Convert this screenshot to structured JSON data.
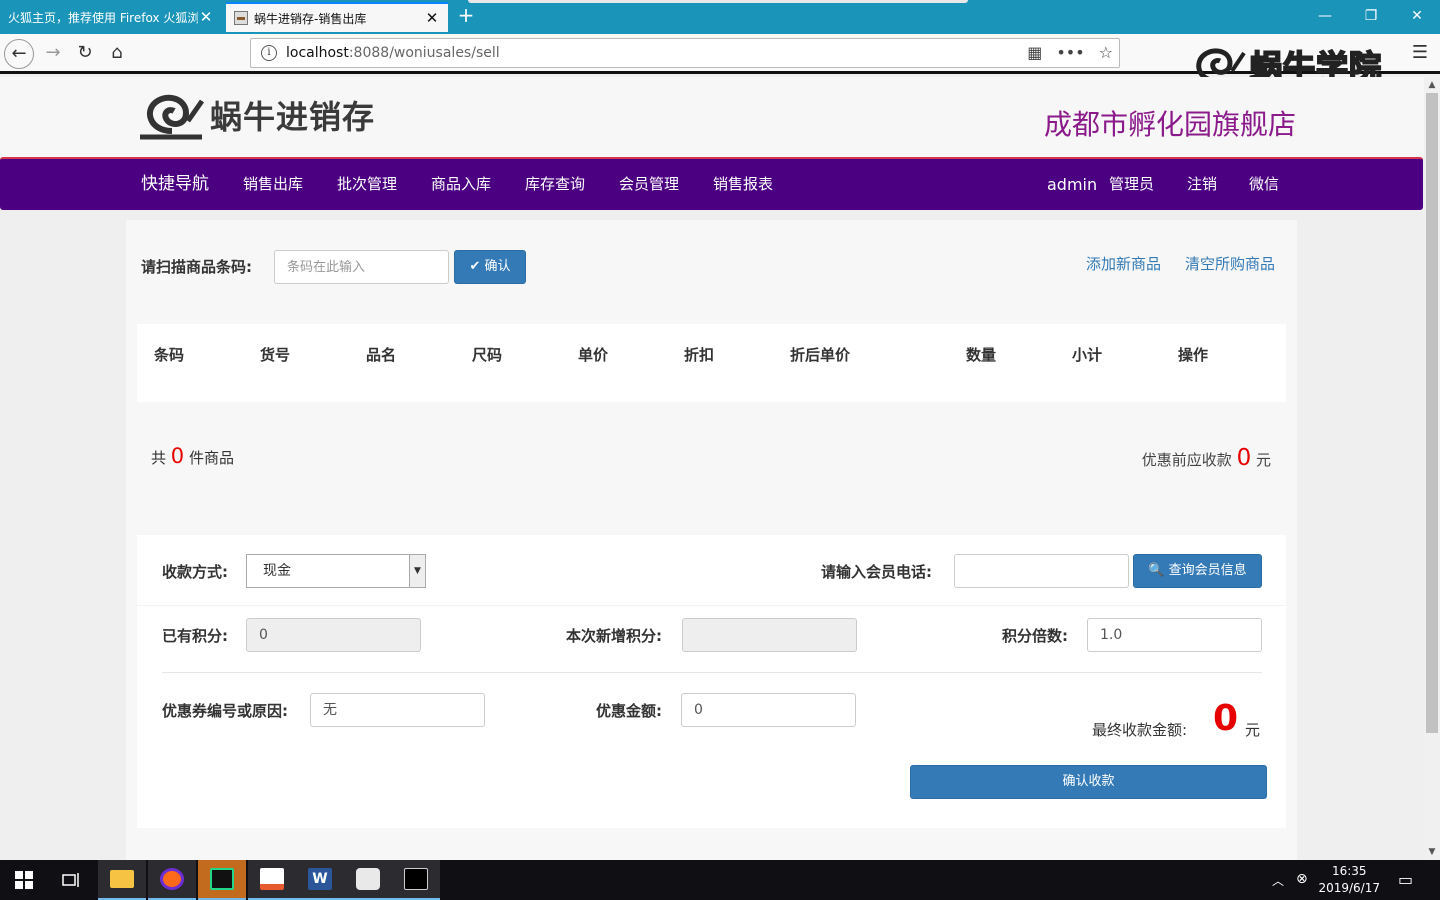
{
  "browser": {
    "tabs": [
      {
        "title": "火狐主页，推荐使用 Firefox 火狐浏览",
        "active": false
      },
      {
        "title": "蜗牛进销存-销售出库",
        "active": true
      }
    ],
    "new_tab": "+",
    "url_host": "localhost",
    "url_path": ":8088/woniusales/sell",
    "icons": [
      "back-icon",
      "forward-icon",
      "reload-icon",
      "home-icon",
      "info-icon",
      "qr-icon",
      "more-icon",
      "bookmark-icon",
      "menu-icon"
    ],
    "watermark_text": "蜗牛学院"
  },
  "header": {
    "logo_text": "蜗牛进销存",
    "store_name": "成都市孵化园旗舰店"
  },
  "nav": {
    "brand": "快捷导航",
    "items": [
      "销售出库",
      "批次管理",
      "商品入库",
      "库存查询",
      "会员管理",
      "销售报表"
    ],
    "user": "admin",
    "role": "管理员",
    "logout": "注销",
    "wechat": "微信"
  },
  "scan": {
    "label": "请扫描商品条码:",
    "placeholder": "条码在此输入",
    "confirm": "确认",
    "add_new": "添加新商品",
    "clear": "清空所购商品"
  },
  "table": {
    "headers": [
      "条码",
      "货号",
      "品名",
      "尺码",
      "单价",
      "折扣",
      "折后单价",
      "数量",
      "小计",
      "操作"
    ],
    "rows": []
  },
  "summary": {
    "count_prefix": "共",
    "count": "0",
    "count_suffix": "件商品",
    "pre_discount_label": "优惠前应收款",
    "pre_discount_value": "0",
    "currency": "元"
  },
  "payment": {
    "method_label": "收款方式:",
    "method_value": "现金",
    "member_phone_label": "请输入会员电话:",
    "member_phone_value": "",
    "query_member": "查询会员信息",
    "points_label": "已有积分:",
    "points_value": "0",
    "new_points_label": "本次新增积分:",
    "new_points_value": "",
    "multiplier_label": "积分倍数:",
    "multiplier_value": "1.0",
    "coupon_label": "优惠券编号或原因:",
    "coupon_value": "无",
    "discount_label": "优惠金额:",
    "discount_value": "0",
    "final_label": "最终收款金额:",
    "final_value": "0",
    "final_currency": "元",
    "confirm_payment": "确认收款"
  },
  "taskbar": {
    "time": "16:35",
    "date": "2019/6/17",
    "apps": [
      "start-icon",
      "task-view-icon",
      "file-explorer-icon",
      "firefox-icon",
      "pycharm-icon",
      "slides-icon",
      "word-icon",
      "java-icon",
      "terminal-icon"
    ]
  },
  "colors": {
    "nav_bg": "#4b0082",
    "nav_top_border": "#d8354a",
    "store_name": "#8b1a8b",
    "primary": "#337ab7",
    "amount_red": "#e60000",
    "tabbar": "#1a94b8"
  }
}
